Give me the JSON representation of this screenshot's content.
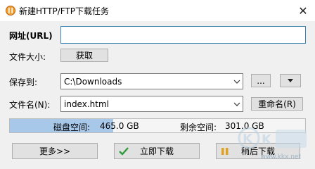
{
  "window": {
    "title": "新建HTTP/FTP下载任务",
    "close_glyph": "✕"
  },
  "form": {
    "url_label": "网址(URL)",
    "url_value": "",
    "size_label": "文件大小:",
    "fetch_button": "获取",
    "saveto_label": "保存到:",
    "saveto_value": "C:\\Downloads",
    "browse_button": "...",
    "filename_label": "文件名(N):",
    "filename_value": "index.html",
    "rename_button": "重命名(R)"
  },
  "disk": {
    "space_label": "磁盘空间:",
    "space_value": "465.0 GB",
    "free_label": "剩余空间:",
    "free_value": "301.0 GB",
    "used_fraction": 0.35
  },
  "actions": {
    "more_button": "更多>>",
    "download_now_button": "立即下载",
    "download_later_button": "稍后下载"
  },
  "icons": {
    "app": "app-icon",
    "check": "check-icon",
    "pause": "pause-icon",
    "dropdown": "chevron-down-icon"
  },
  "watermark": {
    "text": "www.kkx.net"
  },
  "colors": {
    "accent": "#3c7fb1",
    "disk_fill": "#a8c8ea",
    "check_green": "#2e9a3c",
    "pause_orange": "#e0a020"
  }
}
